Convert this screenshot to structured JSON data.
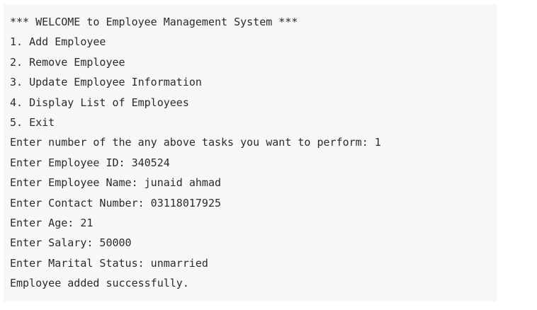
{
  "console": {
    "lines": [
      "*** WELCOME to Employee Management System ***",
      "1. Add Employee",
      "2. Remove Employee",
      "3. Update Employee Information",
      "4. Display List of Employees",
      "5. Exit",
      "Enter number of the any above tasks you want to perform: 1",
      "Enter Employee ID: 340524",
      "Enter Employee Name: junaid ahmad",
      "Enter Contact Number: 03118017925",
      "Enter Age: 21",
      "Enter Salary: 50000",
      "Enter Marital Status: unmarried",
      "Employee added successfully."
    ]
  },
  "colors": {
    "background": "#f7f7f7",
    "text": "#2b2b2b"
  }
}
